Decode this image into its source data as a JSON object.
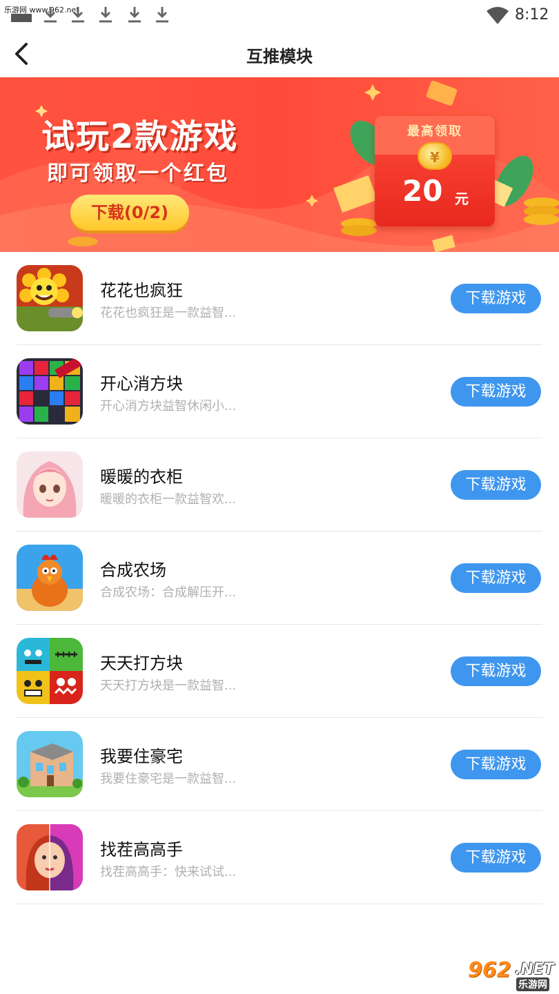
{
  "status_bar": {
    "left_text": "乐游网 www.962.net",
    "time": "8:12"
  },
  "header": {
    "title": "互推模块",
    "back_icon": "chevron-left-icon"
  },
  "banner": {
    "title": "试玩2款游戏",
    "subtitle": "即可领取一个红包",
    "button_label": "下载(0/2)",
    "envelope_label": "最高领取",
    "coin_symbol": "¥",
    "amount": "20",
    "unit": "元"
  },
  "games": [
    {
      "name": "花花也疯狂",
      "desc": "花花也疯狂是一款益智...",
      "button": "下载游戏"
    },
    {
      "name": "开心消方块",
      "desc": "开心消方块益智休闲小...",
      "button": "下载游戏"
    },
    {
      "name": "暖暖的衣柜",
      "desc": "暖暖的衣柜一款益智欢...",
      "button": "下载游戏"
    },
    {
      "name": "合成农场",
      "desc": "合成农场：合成解压开...",
      "button": "下载游戏"
    },
    {
      "name": "天天打方块",
      "desc": "天天打方块是一款益智...",
      "button": "下载游戏"
    },
    {
      "name": "我要住豪宅",
      "desc": "我要住豪宅是一款益智...",
      "button": "下载游戏"
    },
    {
      "name": "找茬高高手",
      "desc": "找茬高高手：快来试试...",
      "button": "下载游戏"
    }
  ],
  "watermark": {
    "number": "962",
    "suffix": ".NET",
    "brand": "乐游网"
  },
  "colors": {
    "accent_blue": "#3e96ee",
    "banner_red": "#ff4b3a",
    "button_yellow": "#ffc629"
  }
}
